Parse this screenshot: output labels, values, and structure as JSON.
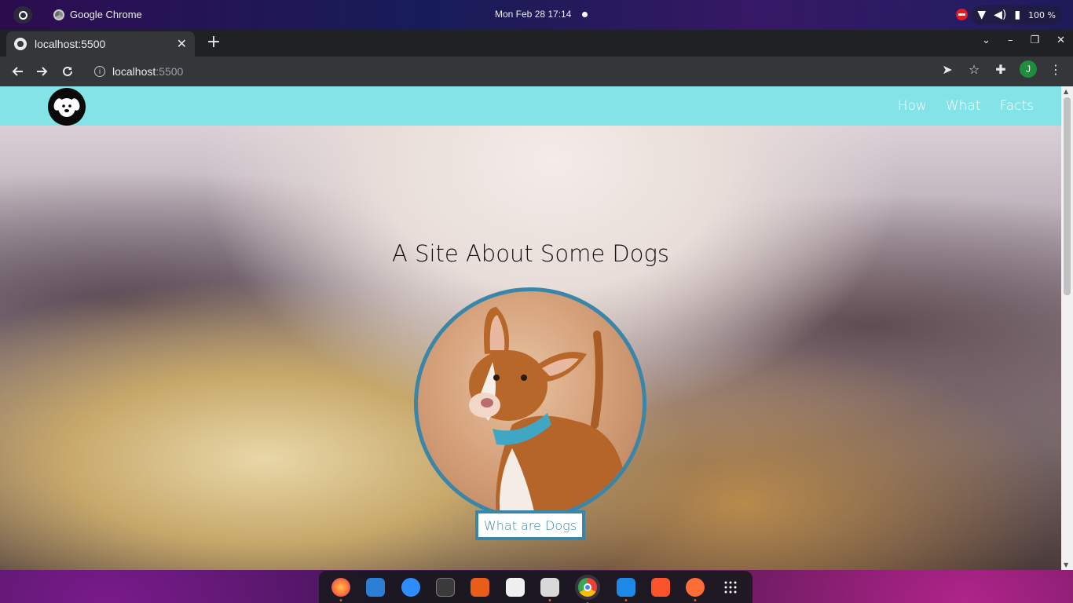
{
  "desktop": {
    "app_name": "Google Chrome",
    "clock": "Mon Feb 28  17:14",
    "battery": "100 %"
  },
  "browser": {
    "tab_title": "localhost:5500",
    "url_host": "localhost",
    "url_port": ":5500",
    "profile_initial": "J"
  },
  "site": {
    "nav_links": [
      "How",
      "What",
      "Facts"
    ],
    "hero_title": "A Site About Some Dogs",
    "cta_label": "What are Dogs"
  },
  "colors": {
    "nav_bg": "#84e3e7",
    "accent_border": "#3a86a8"
  },
  "dock": {
    "apps": [
      "firefox-icon",
      "writer-icon",
      "zoom-icon",
      "terminal-icon",
      "impress-icon",
      "document-viewer-icon",
      "files-icon",
      "chrome-icon",
      "vscode-icon",
      "brave-icon",
      "postman-icon",
      "app-grid-icon"
    ]
  }
}
